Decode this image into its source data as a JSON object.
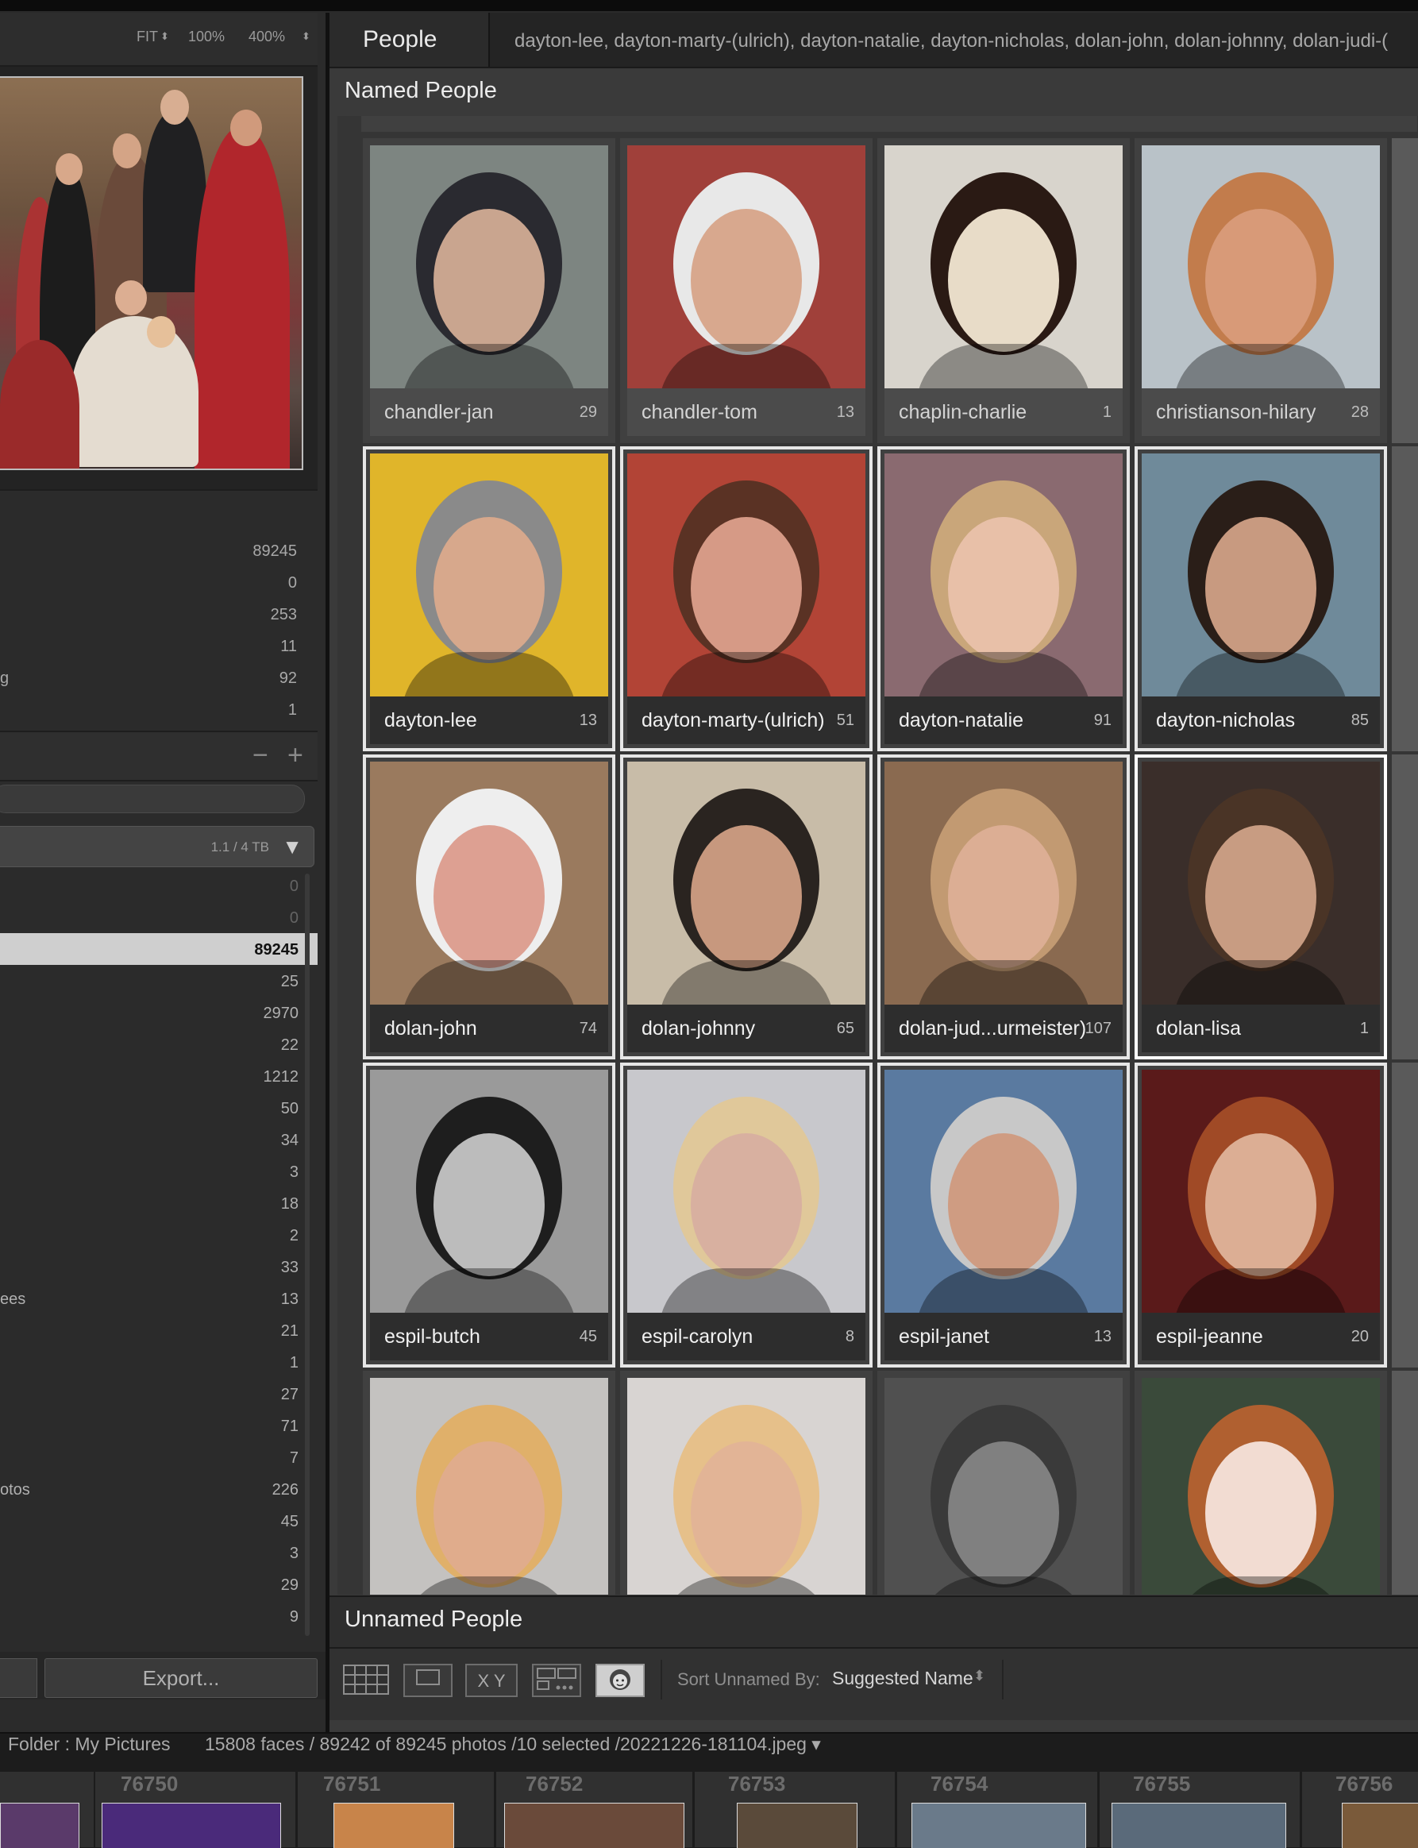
{
  "navigator": {
    "zoom_fit": "FIT",
    "zoom_100": "100%",
    "zoom_400": "400%"
  },
  "catalog": {
    "rows": [
      {
        "label": "",
        "count": "89245"
      },
      {
        "label": "",
        "count": "0"
      },
      {
        "label": "",
        "count": "253"
      },
      {
        "label": "",
        "count": "11"
      },
      {
        "label": "g",
        "count": "92"
      },
      {
        "label": "",
        "count": "1"
      }
    ]
  },
  "panel_tools": {
    "minus": "−",
    "plus": "+"
  },
  "volume": {
    "size": "1.1 / 4 TB",
    "toggle": "▼"
  },
  "folders": [
    {
      "label": "",
      "count": "0",
      "dim": true
    },
    {
      "label": "",
      "count": "0",
      "dim": true
    },
    {
      "label": "",
      "count": "89245",
      "selected": true
    },
    {
      "label": "",
      "count": "25"
    },
    {
      "label": "",
      "count": "2970"
    },
    {
      "label": "",
      "count": "22"
    },
    {
      "label": "",
      "count": "1212"
    },
    {
      "label": "",
      "count": "50"
    },
    {
      "label": "",
      "count": "34"
    },
    {
      "label": "",
      "count": "3"
    },
    {
      "label": "",
      "count": "18"
    },
    {
      "label": "",
      "count": "2"
    },
    {
      "label": "",
      "count": "33"
    },
    {
      "label": "ees",
      "count": "13"
    },
    {
      "label": "",
      "count": "21"
    },
    {
      "label": "",
      "count": "1"
    },
    {
      "label": "",
      "count": "27"
    },
    {
      "label": "",
      "count": "71"
    },
    {
      "label": "",
      "count": "7"
    },
    {
      "label": "otos",
      "count": "226"
    },
    {
      "label": "",
      "count": "45"
    },
    {
      "label": "",
      "count": "3"
    },
    {
      "label": "",
      "count": "29"
    },
    {
      "label": "",
      "count": "9"
    }
  ],
  "buttons": {
    "export": "Export..."
  },
  "people": {
    "tab": "People",
    "selected_list": "dayton-lee,  dayton-marty-(ulrich),  dayton-natalie,  dayton-nicholas,  dolan-john,  dolan-johnny,  dolan-judi-(",
    "named_label": "Named People",
    "unnamed_label": "Unnamed People",
    "faces": [
      {
        "name": "chandler-jan",
        "count": "29",
        "selected": false,
        "skin": "#c9a58f",
        "hair": "#2a2a30",
        "bg": "#7d8581"
      },
      {
        "name": "chandler-tom",
        "count": "13",
        "selected": false,
        "skin": "#d8a88e",
        "hair": "#e8e8e8",
        "bg": "#a0403a"
      },
      {
        "name": "chaplin-charlie",
        "count": "1",
        "selected": false,
        "skin": "#e8dcc8",
        "hair": "#2a1a14",
        "bg": "#d8d4cc"
      },
      {
        "name": "christianson-hilary",
        "count": "28",
        "selected": false,
        "skin": "#d89a78",
        "hair": "#c27c4c",
        "bg": "#b9c2c8"
      },
      {
        "name": "dayton-lee",
        "count": "13",
        "selected": true,
        "skin": "#d7a88c",
        "hair": "#8a8a8a",
        "bg": "#e0b52a"
      },
      {
        "name": "dayton-marty-(ulrich)",
        "count": "51",
        "selected": true,
        "skin": "#d69a86",
        "hair": "#5a3224",
        "bg": "#b24436"
      },
      {
        "name": "dayton-natalie",
        "count": "91",
        "selected": true,
        "skin": "#e8c0a8",
        "hair": "#c9a67a",
        "bg": "#8a6a70"
      },
      {
        "name": "dayton-nicholas",
        "count": "85",
        "selected": true,
        "skin": "#c89a80",
        "hair": "#2a1e18",
        "bg": "#6f8a9a"
      },
      {
        "name": "dolan-john",
        "count": "74",
        "selected": true,
        "skin": "#dda092",
        "hair": "#eeeeee",
        "bg": "#9a7a5e"
      },
      {
        "name": "dolan-johnny",
        "count": "65",
        "selected": true,
        "skin": "#c7987e",
        "hair": "#2a2420",
        "bg": "#c8bca8"
      },
      {
        "name": "dolan-jud...urmeister)",
        "count": "107",
        "selected": true,
        "skin": "#dcae94",
        "hair": "#c29a72",
        "bg": "#8a6a50"
      },
      {
        "name": "dolan-lisa",
        "count": "1",
        "selected": true,
        "strong": true,
        "skin": "#c89c82",
        "hair": "#4a3426",
        "bg": "#3a2e2a"
      },
      {
        "name": "espil-butch",
        "count": "45",
        "selected": true,
        "skin": "#bcbcbc",
        "hair": "#1e1e1e",
        "bg": "#9a9a9a"
      },
      {
        "name": "espil-carolyn",
        "count": "8",
        "selected": true,
        "skin": "#d8b0a0",
        "hair": "#e0c89a",
        "bg": "#c8c8cc"
      },
      {
        "name": "espil-janet",
        "count": "13",
        "selected": true,
        "skin": "#cf9c82",
        "hair": "#c8c8c8",
        "bg": "#5a7aa0"
      },
      {
        "name": "espil-jeanne",
        "count": "20",
        "selected": true,
        "skin": "#dcae94",
        "hair": "#a04a26",
        "bg": "#5a1a1a"
      },
      {
        "name": "",
        "count": "",
        "selected": false,
        "skin": "#e0ac8c",
        "hair": "#e0b06a",
        "bg": "#c4c2c0"
      },
      {
        "name": "",
        "count": "",
        "selected": false,
        "skin": "#e2b496",
        "hair": "#e6c08a",
        "bg": "#d8d4d2"
      },
      {
        "name": "",
        "count": "",
        "selected": false,
        "skin": "#808080",
        "hair": "#3a3a3a",
        "bg": "#505050"
      },
      {
        "name": "",
        "count": "",
        "selected": false,
        "skin": "#f2dcd2",
        "hair": "#b06030",
        "bg": "#3a4a3a"
      }
    ]
  },
  "toolbar": {
    "sort_label": "Sort Unnamed By:",
    "sort_value": "Suggested Name",
    "sort_arrow": "⌃⌄",
    "xy_label": "X Y"
  },
  "status": {
    "folder": "Folder : My Pictures",
    "info": "15808 faces / 89242 of 89245 photos /10 selected /20221226-181104.jpeg ▾"
  },
  "filmstrip": {
    "numbers": [
      "76750",
      "76751",
      "76752",
      "76753",
      "76754",
      "76755",
      "76756"
    ]
  }
}
